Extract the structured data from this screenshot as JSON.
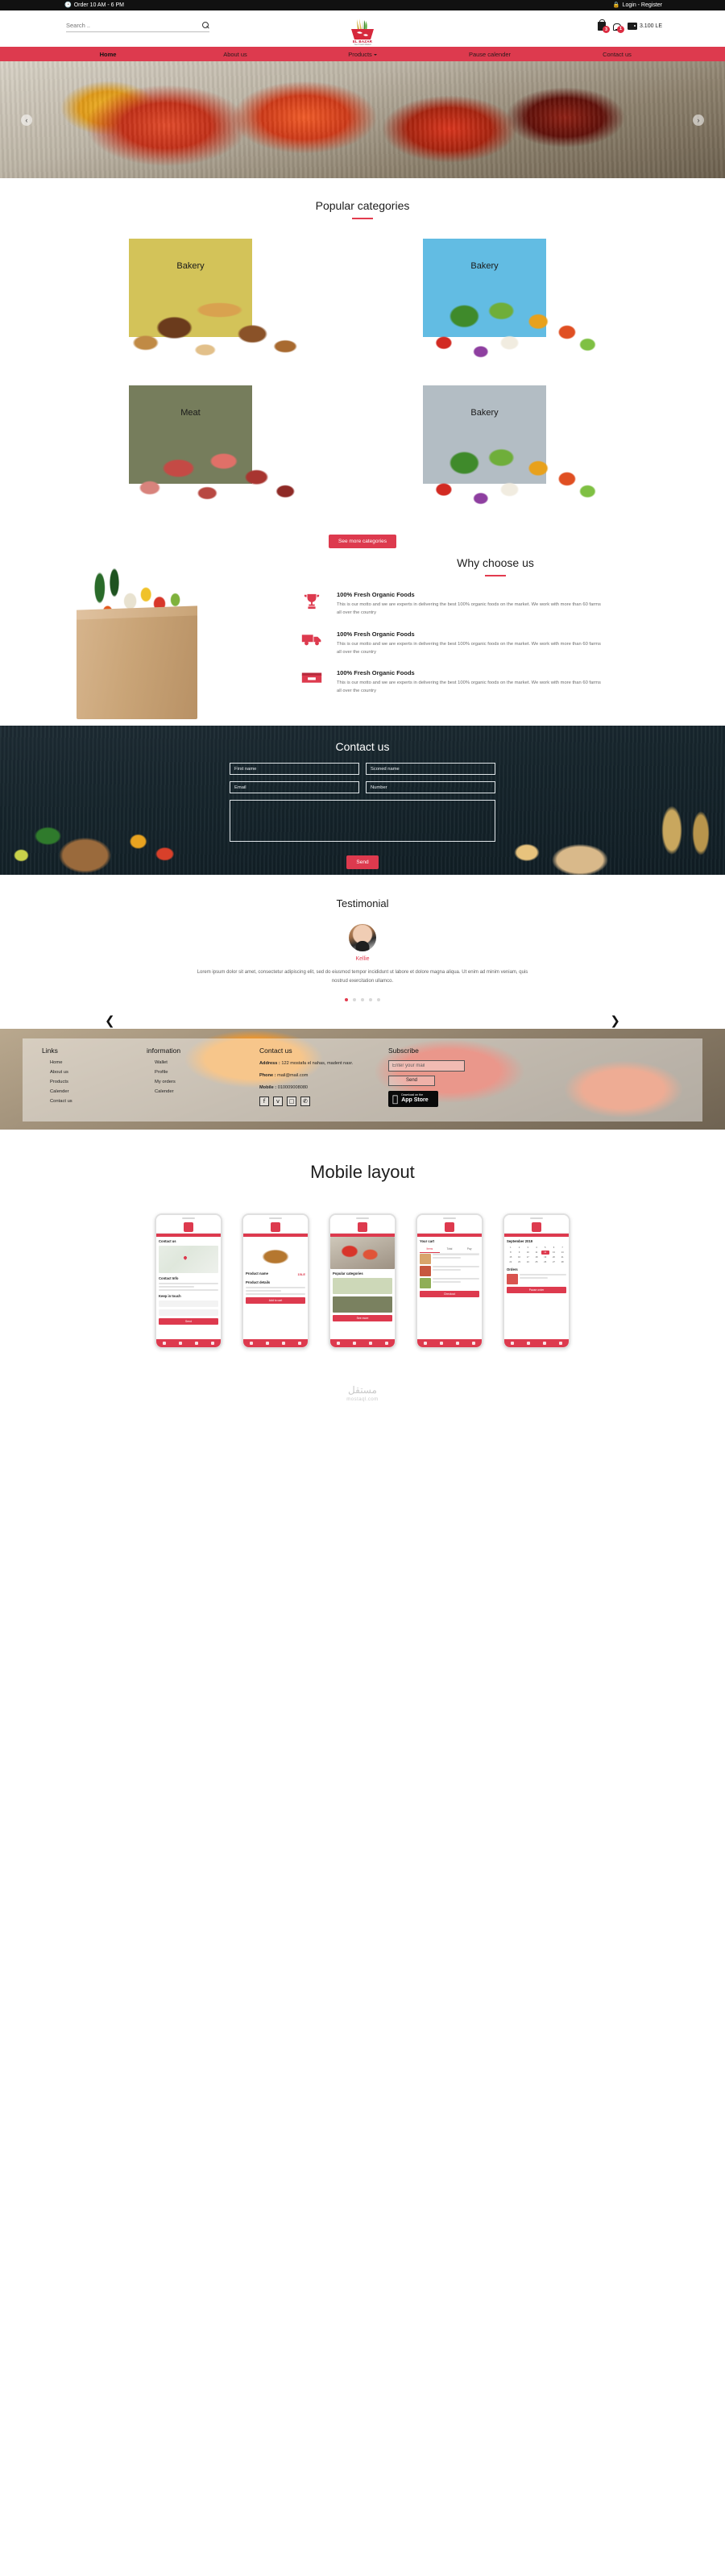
{
  "topbar": {
    "clock_icon": "clock-icon",
    "hours": "Order 10 AM - 6 PM",
    "lock_icon": "lock-icon",
    "login": "Login - Register"
  },
  "header": {
    "search_placeholder": "Search ..",
    "search_value": "",
    "logo_name": "EL BAZAR",
    "logo_tagline": "Your Fresh Market",
    "cart_badge": "3",
    "bell_badge": "1",
    "wallet_amount": "3.100 LE"
  },
  "nav": {
    "items": [
      {
        "label": "Home",
        "active": true,
        "caret": false
      },
      {
        "label": "About us",
        "active": false,
        "caret": false
      },
      {
        "label": "Products",
        "active": false,
        "caret": true
      },
      {
        "label": "Pause calender",
        "active": false,
        "caret": false
      },
      {
        "label": "Contact us",
        "active": false,
        "caret": false
      }
    ]
  },
  "hero": {
    "prev_icon": "chevron-left-icon",
    "next_icon": "chevron-right-icon"
  },
  "categories": {
    "title": "Popular categories",
    "items": [
      {
        "label": "Bakery",
        "color": "#d3c359",
        "img": "bread"
      },
      {
        "label": "Bakery",
        "color": "#62bce3",
        "img": "veg"
      },
      {
        "label": "Meat",
        "color": "#767d5c",
        "img": "meat"
      },
      {
        "label": "Bakery",
        "color": "#b3bdc4",
        "img": "veg"
      }
    ],
    "see_more": "See more categories"
  },
  "why": {
    "title": "Why choose us",
    "features": [
      {
        "icon": "trophy-icon",
        "heading": "100% Fresh Organic Foods",
        "text": "This is our motto and we are experts in delivering the best 100% organic foods on the market. We work with more than 60 farms all over the country"
      },
      {
        "icon": "truck-icon",
        "heading": "100% Fresh Organic Foods",
        "text": "This is our motto and we are experts in delivering the best 100% organic foods on the market. We work with more than 60 farms all over the country"
      },
      {
        "icon": "box-icon",
        "heading": "100% Fresh Organic Foods",
        "text": "This is our motto and we are experts in delivering the best 100% organic foods on the market. We work with more than 60 farms all over the country"
      }
    ]
  },
  "contact": {
    "title": "Contact us",
    "first_name_placeholder": "First name",
    "second_name_placeholder": "Sconed name",
    "email_placeholder": "Email",
    "number_placeholder": "Number",
    "message_placeholder": "",
    "send_label": "Send"
  },
  "testimonial": {
    "title": "Testimonial",
    "name": "Kellie",
    "quote": "Lorem ipsum dolor sit amet, consectetur adipiscing elit, sed do eiusmod tempor incididunt ut labore et dolore magna aliqua. Ut enim ad minim veniam, quis nostrud exercitation ullamco.",
    "prev_icon": "chevron-left-icon",
    "next_icon": "chevron-right-icon",
    "dots": 5,
    "active_dot": 0
  },
  "footer": {
    "links": {
      "title": "Links",
      "items": [
        "Home",
        "About us",
        "Products",
        "Calender",
        "Contact us"
      ]
    },
    "information": {
      "title": "information",
      "items": [
        "Wallet",
        "Profile",
        "My orders",
        "Calender"
      ]
    },
    "contact": {
      "title": "Contact us",
      "address_label": "Address :",
      "address_value": "122 mostafa el nahas, madent nasr.",
      "phone_label": "Phone :",
      "phone_value": "mail@mail.com",
      "mobile_label": "Mobile :",
      "mobile_value": "010009008080",
      "socials": [
        {
          "name": "facebook-icon",
          "glyph": "f"
        },
        {
          "name": "twitter-icon",
          "glyph": "ᴠ"
        },
        {
          "name": "instagram-icon",
          "glyph": "□"
        },
        {
          "name": "whatsapp-icon",
          "glyph": "✆"
        }
      ]
    },
    "subscribe": {
      "title": "Subscribe",
      "input_placeholder": "Enter your mail",
      "input_value": "",
      "send_label": "Send",
      "appstore_small": "Download on the",
      "appstore_big": "App Store"
    }
  },
  "mobile": {
    "title": "Mobile layout",
    "screens": [
      {
        "name": "contact-screen",
        "title": "Contact us",
        "sub1": "Contact Info",
        "sub2": "Keep in touch",
        "cta": "Send"
      },
      {
        "name": "product-screen",
        "title": "Product name",
        "price": "15LE",
        "sub1": "Product details",
        "cta": "Add to cart"
      },
      {
        "name": "categories-screen",
        "title": "Popular categories",
        "cta": "See more"
      },
      {
        "name": "cart-screen",
        "title": "Your cart",
        "tabs": [
          "Items",
          "Total",
          "Pay"
        ],
        "cta": "Checkout"
      },
      {
        "name": "calendar-screen",
        "title": "September 2019",
        "sub1": "Orders",
        "cta": "Pause order"
      }
    ]
  },
  "watermark": {
    "text": "مستقل",
    "sub": "mostaql.com"
  },
  "colors": {
    "brand_red": "#dd3a4e",
    "accent_red": "#e23b4e",
    "dark": "#111111"
  }
}
